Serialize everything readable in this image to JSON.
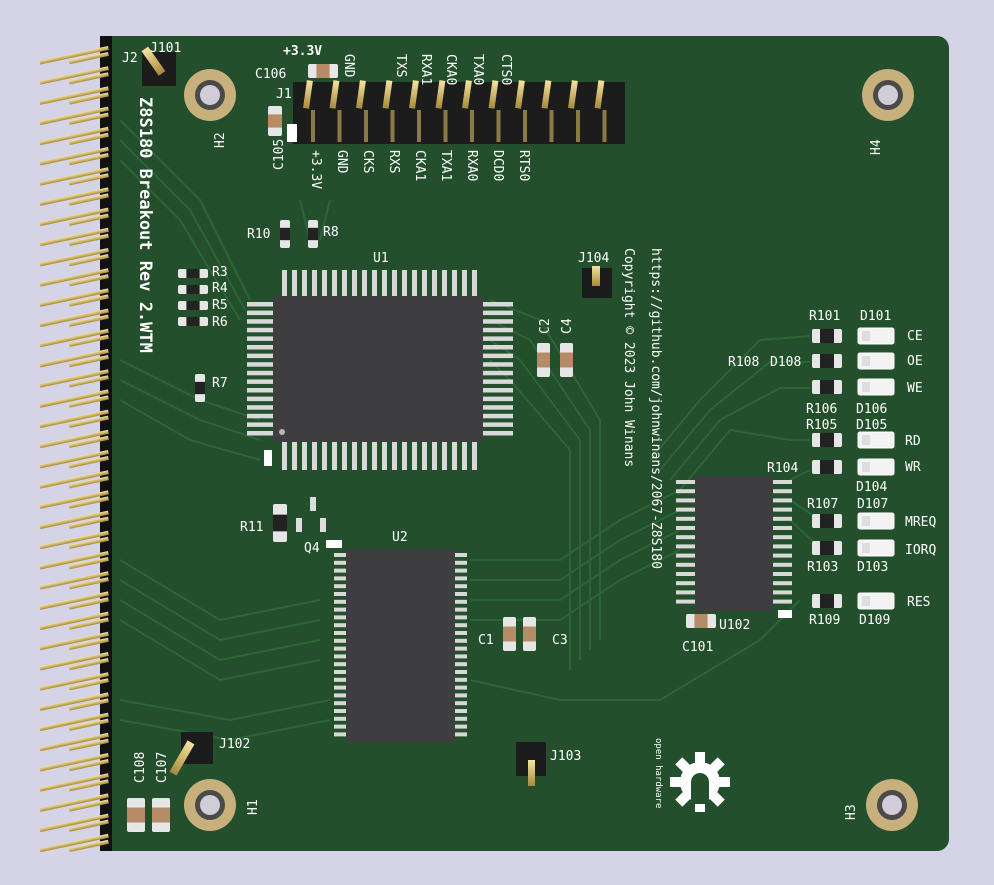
{
  "board": {
    "title": "Z8S180 Breakout Rev 2.WTM",
    "url": "https://github.com/johnwinans/2067-Z8S180",
    "copyright": "Copyright © 2023 John Winans",
    "oshw_label": "open hardware",
    "colors": {
      "pcb": "#234f2c",
      "trace": "#2d6438",
      "silk": "#ffffff",
      "pad": "#c8a84a",
      "ic": "#3e3d3f",
      "bg": "#d4d4e6"
    }
  },
  "refs": {
    "J101": "J101",
    "J2": "J2",
    "H2": "H2",
    "H4": "H4",
    "H1": "H1",
    "H3": "H3",
    "J1": "J1",
    "C105": "C105",
    "C106": "C106",
    "R10": "R10",
    "R8": "R8",
    "U1": "U1",
    "J104": "J104",
    "R3": "R3",
    "R4": "R4",
    "R5": "R5",
    "R6": "R6",
    "R7": "R7",
    "C2": "C2",
    "C4": "C4",
    "R11": "R11",
    "Q4": "Q4",
    "U2": "U2",
    "C1": "C1",
    "C3": "C3",
    "J102": "J102",
    "J103": "J103",
    "C107": "C107",
    "C108": "C108",
    "U102": "U102",
    "C101": "C101",
    "R101": "R101",
    "D101": "D101",
    "R108": "R108",
    "D108": "D108",
    "R106": "R106",
    "D106": "D106",
    "R105": "R105",
    "D105": "D105",
    "R104": "R104",
    "D104": "D104",
    "R107": "R107",
    "D107": "D107",
    "R103": "R103",
    "D103": "D103",
    "R109": "R109",
    "D109": "D109"
  },
  "header_top_labels": [
    "+3.3V",
    "GND",
    "TXS",
    "RXA1",
    "CKA0",
    "TXA0",
    "CTS0"
  ],
  "header_bottom_labels": [
    "+3.3V",
    "GND",
    "CKS",
    "RXS",
    "CKA1",
    "TXA1",
    "RXA0",
    "DCD0",
    "RTS0"
  ],
  "led_labels": [
    "CE",
    "OE",
    "WE",
    "RD",
    "WR",
    "MREQ",
    "IORQ",
    "RES"
  ]
}
